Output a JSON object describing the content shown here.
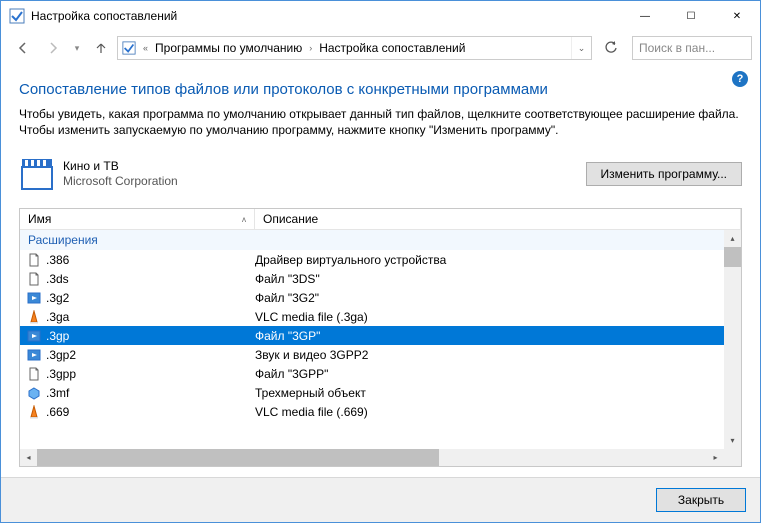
{
  "window": {
    "title": "Настройка сопоставлений"
  },
  "titlebar": {
    "minimize": "—",
    "maximize": "☐",
    "close": "✕"
  },
  "nav": {
    "breadcrumb": [
      "Программы по умолчанию",
      "Настройка сопоставлений"
    ],
    "search_placeholder": "Поиск в пан..."
  },
  "page": {
    "heading": "Сопоставление типов файлов или протоколов с конкретными программами",
    "description": "Чтобы увидеть, какая программа по умолчанию открывает данный тип файлов, щелкните соответствующее расширение файла. Чтобы изменить запускаемую по умолчанию программу, нажмите кнопку \"Изменить программу\"."
  },
  "app": {
    "name": "Кино и ТВ",
    "publisher": "Microsoft Corporation",
    "change_label": "Изменить программу..."
  },
  "columns": {
    "name": "Имя",
    "desc": "Описание"
  },
  "group_label": "Расширения",
  "rows": [
    {
      "icon": "file",
      "name": ".386",
      "desc": "Драйвер виртуального устройства",
      "selected": false
    },
    {
      "icon": "file",
      "name": ".3ds",
      "desc": "Файл \"3DS\"",
      "selected": false
    },
    {
      "icon": "video",
      "name": ".3g2",
      "desc": "Файл \"3G2\"",
      "selected": false
    },
    {
      "icon": "vlc",
      "name": ".3ga",
      "desc": "VLC media file (.3ga)",
      "selected": false
    },
    {
      "icon": "video",
      "name": ".3gp",
      "desc": "Файл \"3GP\"",
      "selected": true
    },
    {
      "icon": "video",
      "name": ".3gp2",
      "desc": "Звук и видео 3GPP2",
      "selected": false
    },
    {
      "icon": "file",
      "name": ".3gpp",
      "desc": "Файл \"3GPP\"",
      "selected": false
    },
    {
      "icon": "3d",
      "name": ".3mf",
      "desc": "Трехмерный объект",
      "selected": false
    },
    {
      "icon": "vlc",
      "name": ".669",
      "desc": "VLC media file (.669)",
      "selected": false
    }
  ],
  "footer": {
    "close_label": "Закрыть"
  }
}
